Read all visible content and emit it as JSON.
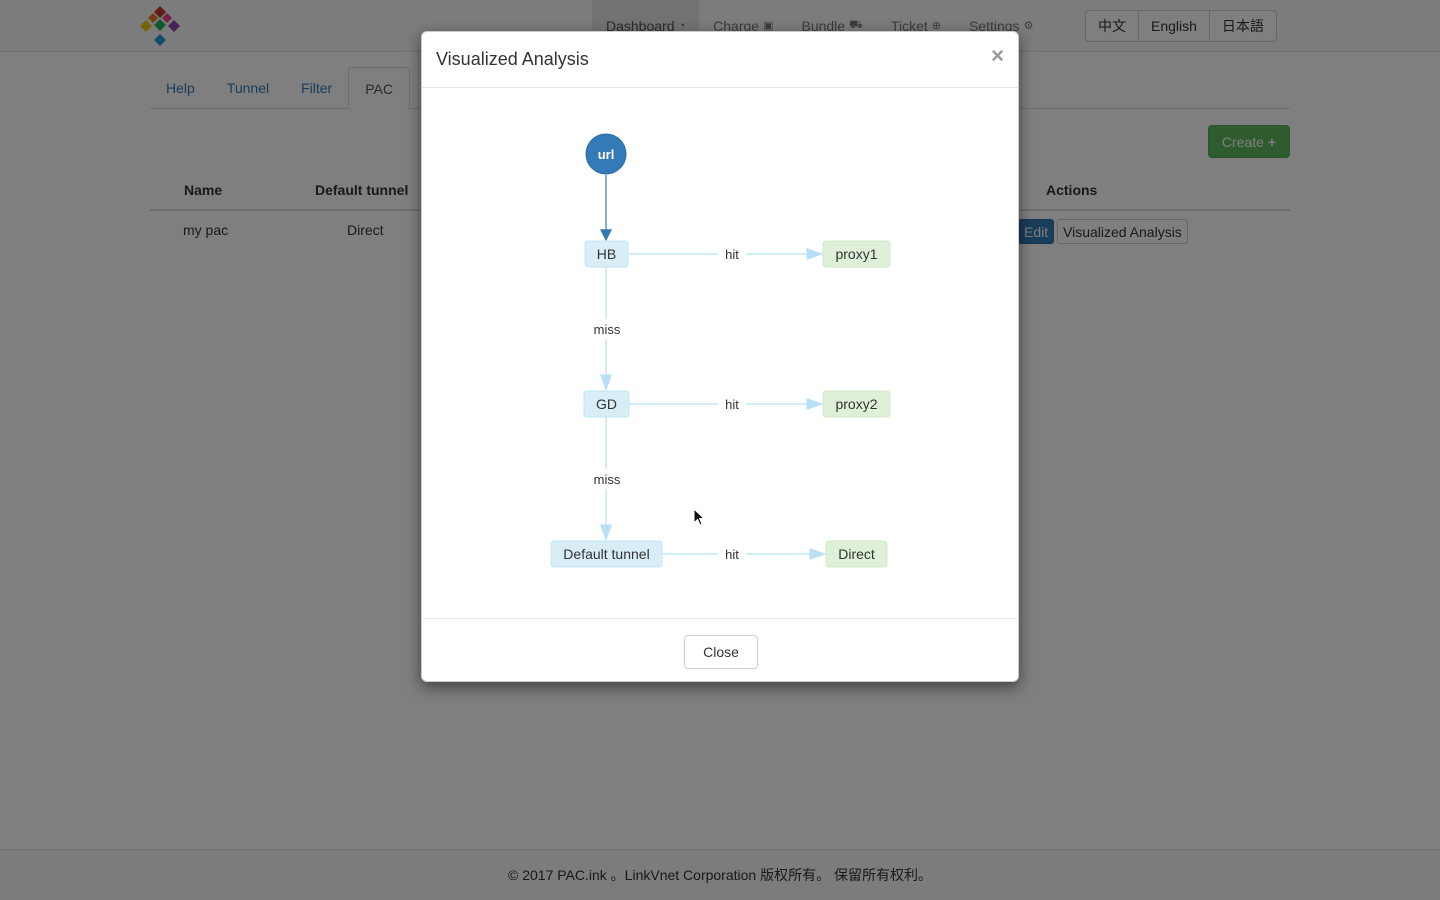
{
  "nav": {
    "items": [
      {
        "label": "Dashboard",
        "icon": "dashboard-icon",
        "active": true
      },
      {
        "label": "Charge",
        "icon": "money-icon"
      },
      {
        "label": "Bundle",
        "icon": "cart-icon"
      },
      {
        "label": "Ticket",
        "icon": "lifebuoy-icon"
      },
      {
        "label": "Settings",
        "icon": "gear-icon"
      }
    ],
    "languages": [
      "中文",
      "English",
      "日本語"
    ]
  },
  "tabs": [
    "Help",
    "Tunnel",
    "Filter",
    "PAC"
  ],
  "active_tab": "PAC",
  "create_label": "Create",
  "table": {
    "headers": [
      "Name",
      "Default tunnel",
      "Actions"
    ],
    "rows": [
      {
        "name": "my pac",
        "default_tunnel": "Direct",
        "edit_label": "Edit",
        "analysis_label": "Visualized Analysis"
      }
    ]
  },
  "footer": "© 2017 PAC.ink 。LinkVnet Corporation 版权所有。 保留所有权利。",
  "modal": {
    "title": "Visualized Analysis",
    "close_x": "×",
    "close_label": "Close",
    "graph": {
      "start": "url",
      "rules": [
        "HB",
        "GD",
        "Default tunnel"
      ],
      "targets": [
        "proxy1",
        "proxy2",
        "Direct"
      ],
      "hit_label": "hit",
      "miss_label": "miss"
    }
  },
  "colors": {
    "primary": "#337ab7",
    "success": "#5cb85c",
    "rule_fill": "#d9edf7",
    "rule_stroke": "#bce8f1",
    "target_fill": "#dff0d8",
    "target_stroke": "#d6e9c6",
    "edge": "#b8e0f5"
  }
}
